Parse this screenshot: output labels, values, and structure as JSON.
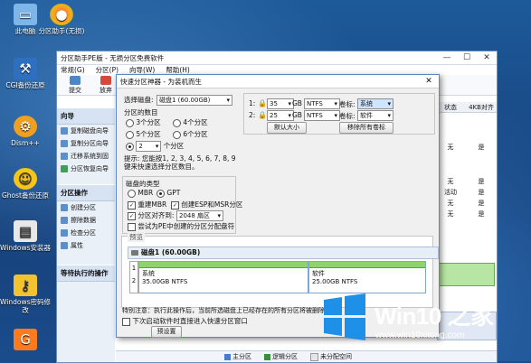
{
  "desktop": {
    "icons": [
      {
        "name": "this-pc",
        "label": "此电脑",
        "icon": "computer-icon"
      },
      {
        "name": "partition-assistant",
        "label": "分区助手(无损)",
        "icon": "partition-icon"
      },
      {
        "name": "cgi-backup",
        "label": "CGI备份还原",
        "icon": "cgi-icon"
      },
      {
        "name": "dism",
        "label": "Dism++",
        "icon": "gear-icon"
      },
      {
        "name": "ghost-backup",
        "label": "Ghost备份还原",
        "icon": "ghost-icon"
      },
      {
        "name": "windows-installer",
        "label": "Windows安装器",
        "icon": "installer-icon"
      },
      {
        "name": "windows-password",
        "label": "Windows密码修改",
        "icon": "key-icon"
      },
      {
        "name": "disk-tool",
        "label": "",
        "icon": "disk-icon"
      }
    ]
  },
  "app": {
    "title": "分区助手PE版 - 无损分区免费软件",
    "menu": [
      "常规(G)",
      "分区(P)",
      "向导(W)",
      "帮助(H)"
    ],
    "toolbar": [
      "提交",
      "放弃"
    ],
    "sidebar": {
      "section1": "向导",
      "wizard_items": [
        "复制磁盘向导",
        "复制分区向导",
        "迁移系统到固",
        "分区恢复向导"
      ],
      "section2": "分区操作",
      "ops_items": [
        "创建分区",
        "擦除数据",
        "检查分区",
        "属性"
      ],
      "section3": "等待执行的操作"
    },
    "grid": {
      "headers": [
        "状态",
        "4KB对齐"
      ],
      "rows": [
        [
          "无",
          "是"
        ],
        [
          "无",
          "是"
        ],
        [
          "活动",
          "是"
        ],
        [
          "无",
          "是"
        ],
        [
          "无",
          "是"
        ]
      ]
    },
    "legend": [
      "主分区",
      "逻辑分区",
      "未分配空间"
    ],
    "colors": {
      "primary": "#4a7bd0",
      "logical": "#3b8f3b",
      "unalloc": "#e6e6e6"
    }
  },
  "dialog": {
    "title": "快速分区神器 - 为装机而生",
    "close": "✕",
    "disk_label": "选择磁盘:",
    "disk_value": "磁盘1 (60.00GB)",
    "count_label": "分区的数目",
    "count_options": [
      "3个分区",
      "4个分区",
      "5个分区",
      "6个分区"
    ],
    "count_custom": "2",
    "count_custom_suffix": "个分区",
    "tip": "提示: 您能按1, 2, 3, 4, 5, 6, 7, 8, 9键来快速选择分区数目。",
    "disk_type_label": "磁盘的类型",
    "mbr": "MBR",
    "gpt": "GPT",
    "rebuild_mbr": "重建MBR",
    "create_esp": "创建ESP和MSR分区",
    "align_label": "分区对齐到:",
    "align_value": "2048 扇区",
    "try_pe": "尝试为PE中创建的分区分配盘符",
    "partitions": [
      {
        "index": "1:",
        "size": "35",
        "unit": "GB",
        "fs": "NTFS",
        "vol_label": "卷标:",
        "vol": "系统"
      },
      {
        "index": "2:",
        "size": "25",
        "unit": "GB",
        "fs": "NTFS",
        "vol_label": "卷标:",
        "vol": "软件"
      }
    ],
    "default_size": "默认大小",
    "remove_labels": "移除所有卷标",
    "preview_label": "预览",
    "preview_disk": "磁盘1 (60.00GB)",
    "preview_parts": [
      {
        "num": "1",
        "name": "系统",
        "detail": "35.00GB NTFS"
      },
      {
        "num": "2",
        "name": "软件",
        "detail": "25.00GB NTFS"
      }
    ],
    "footer_tip": "特别注意：执行此操作后，当前所选磁盘上已经存在的所有分区将被删除",
    "next_time": "下次启动软件时直接进入快速分区窗口",
    "preset": "预设置"
  },
  "watermark": {
    "brand": "Win10 之家",
    "url": "www.win10xitong.com"
  }
}
